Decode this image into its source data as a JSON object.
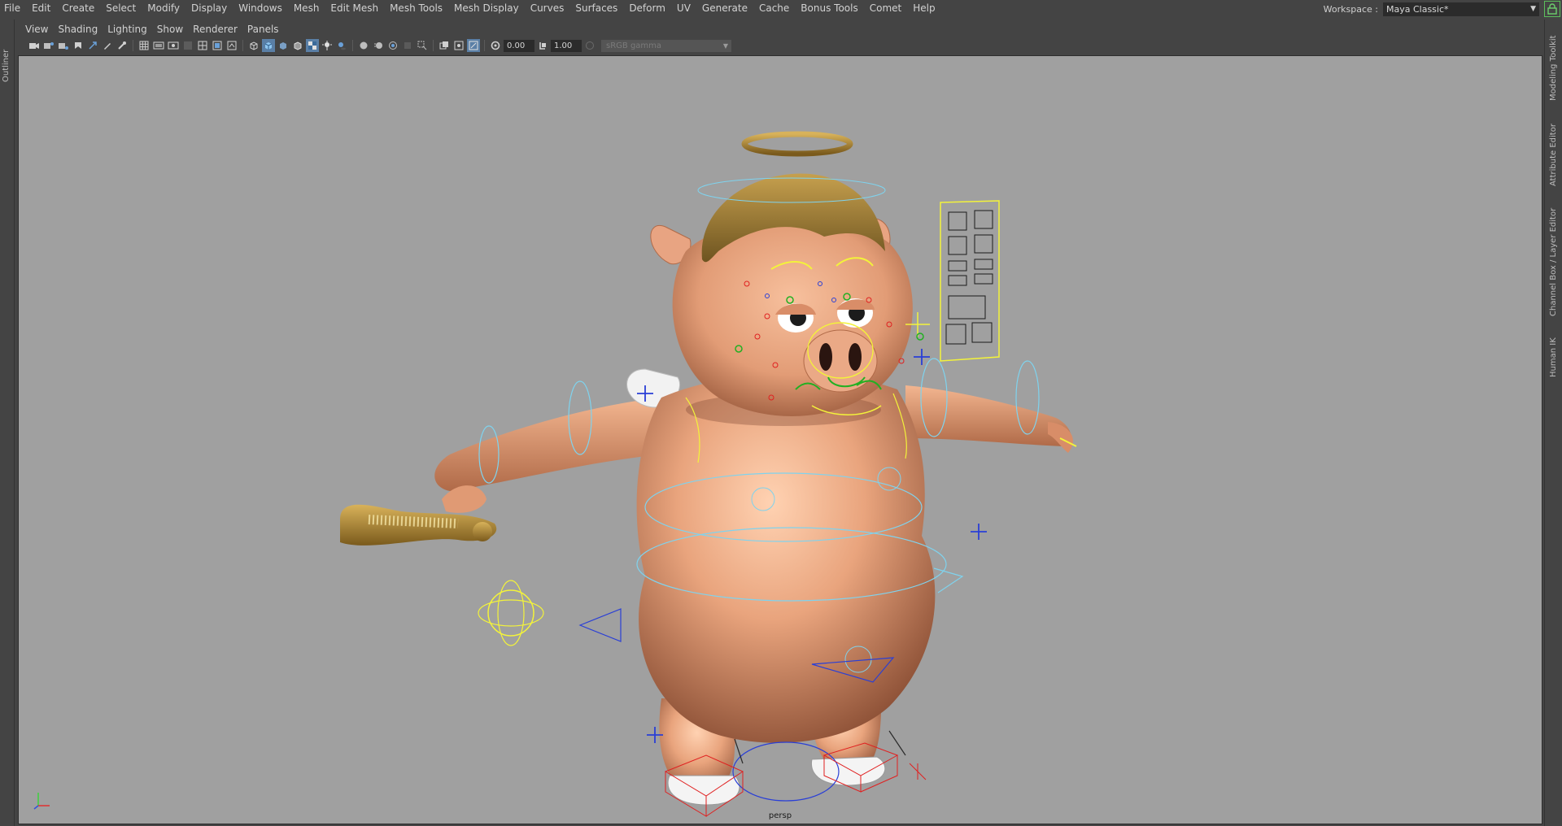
{
  "main_menu": [
    "File",
    "Edit",
    "Create",
    "Select",
    "Modify",
    "Display",
    "Windows",
    "Mesh",
    "Edit Mesh",
    "Mesh Tools",
    "Mesh Display",
    "Curves",
    "Surfaces",
    "Deform",
    "UV",
    "Generate",
    "Cache",
    "Bonus Tools",
    "Comet",
    "Help"
  ],
  "workspace": {
    "label": "Workspace :",
    "value": "Maya Classic*"
  },
  "left_strip": {
    "outliner_tab": "Outliner"
  },
  "right_tabs": [
    "Modeling Toolkit",
    "Attribute Editor",
    "Channel Box / Layer Editor",
    "Human IK"
  ],
  "panel_menu": [
    "View",
    "Shading",
    "Lighting",
    "Show",
    "Renderer",
    "Panels"
  ],
  "toolbar": {
    "exposure": "0.00",
    "gamma": "1.00",
    "color_space": "sRGB gamma"
  },
  "viewport": {
    "camera": "persp"
  },
  "colors": {
    "ui_bg": "#444444",
    "viewport_bg": "#a0a0a0",
    "skin": "#e6a27c",
    "gold": "#a8852e",
    "control_cyan": "#7fd3ee",
    "control_yellow": "#f3f33a",
    "control_blue": "#2a3fd6",
    "control_red": "#e02020"
  }
}
